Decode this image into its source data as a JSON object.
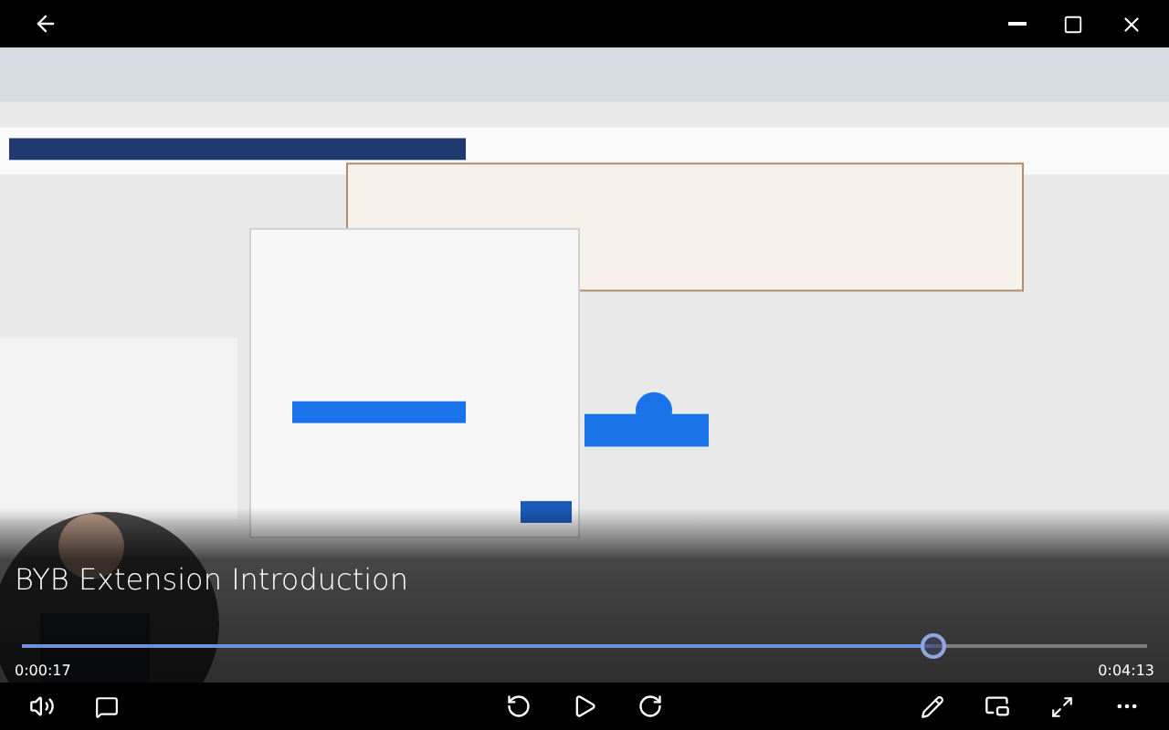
{
  "video": {
    "kind": "picture",
    "title": "BYB Extension Introduction"
  },
  "progress": {
    "level": 0.81,
    "elapsed": "0:00:17",
    "total": "0:04:13"
  }
}
